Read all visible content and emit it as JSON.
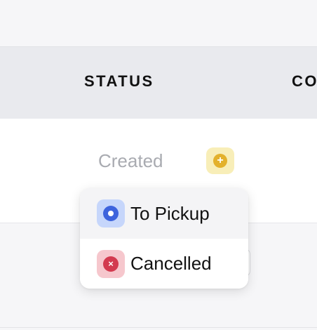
{
  "table": {
    "headers": [
      "STATUS",
      "CO"
    ],
    "row": {
      "status": "Created"
    }
  },
  "dropdown": {
    "options": [
      {
        "label": "To Pickup",
        "icon": "circle-dot-icon",
        "color": "#3d63dd"
      },
      {
        "label": "Cancelled",
        "icon": "x-circle-icon",
        "color": "#d33a4f"
      }
    ]
  },
  "add_button": {
    "icon": "plus-circle-icon",
    "glyph": "+",
    "color": "#e3b12c"
  },
  "cancel_glyph": "×"
}
